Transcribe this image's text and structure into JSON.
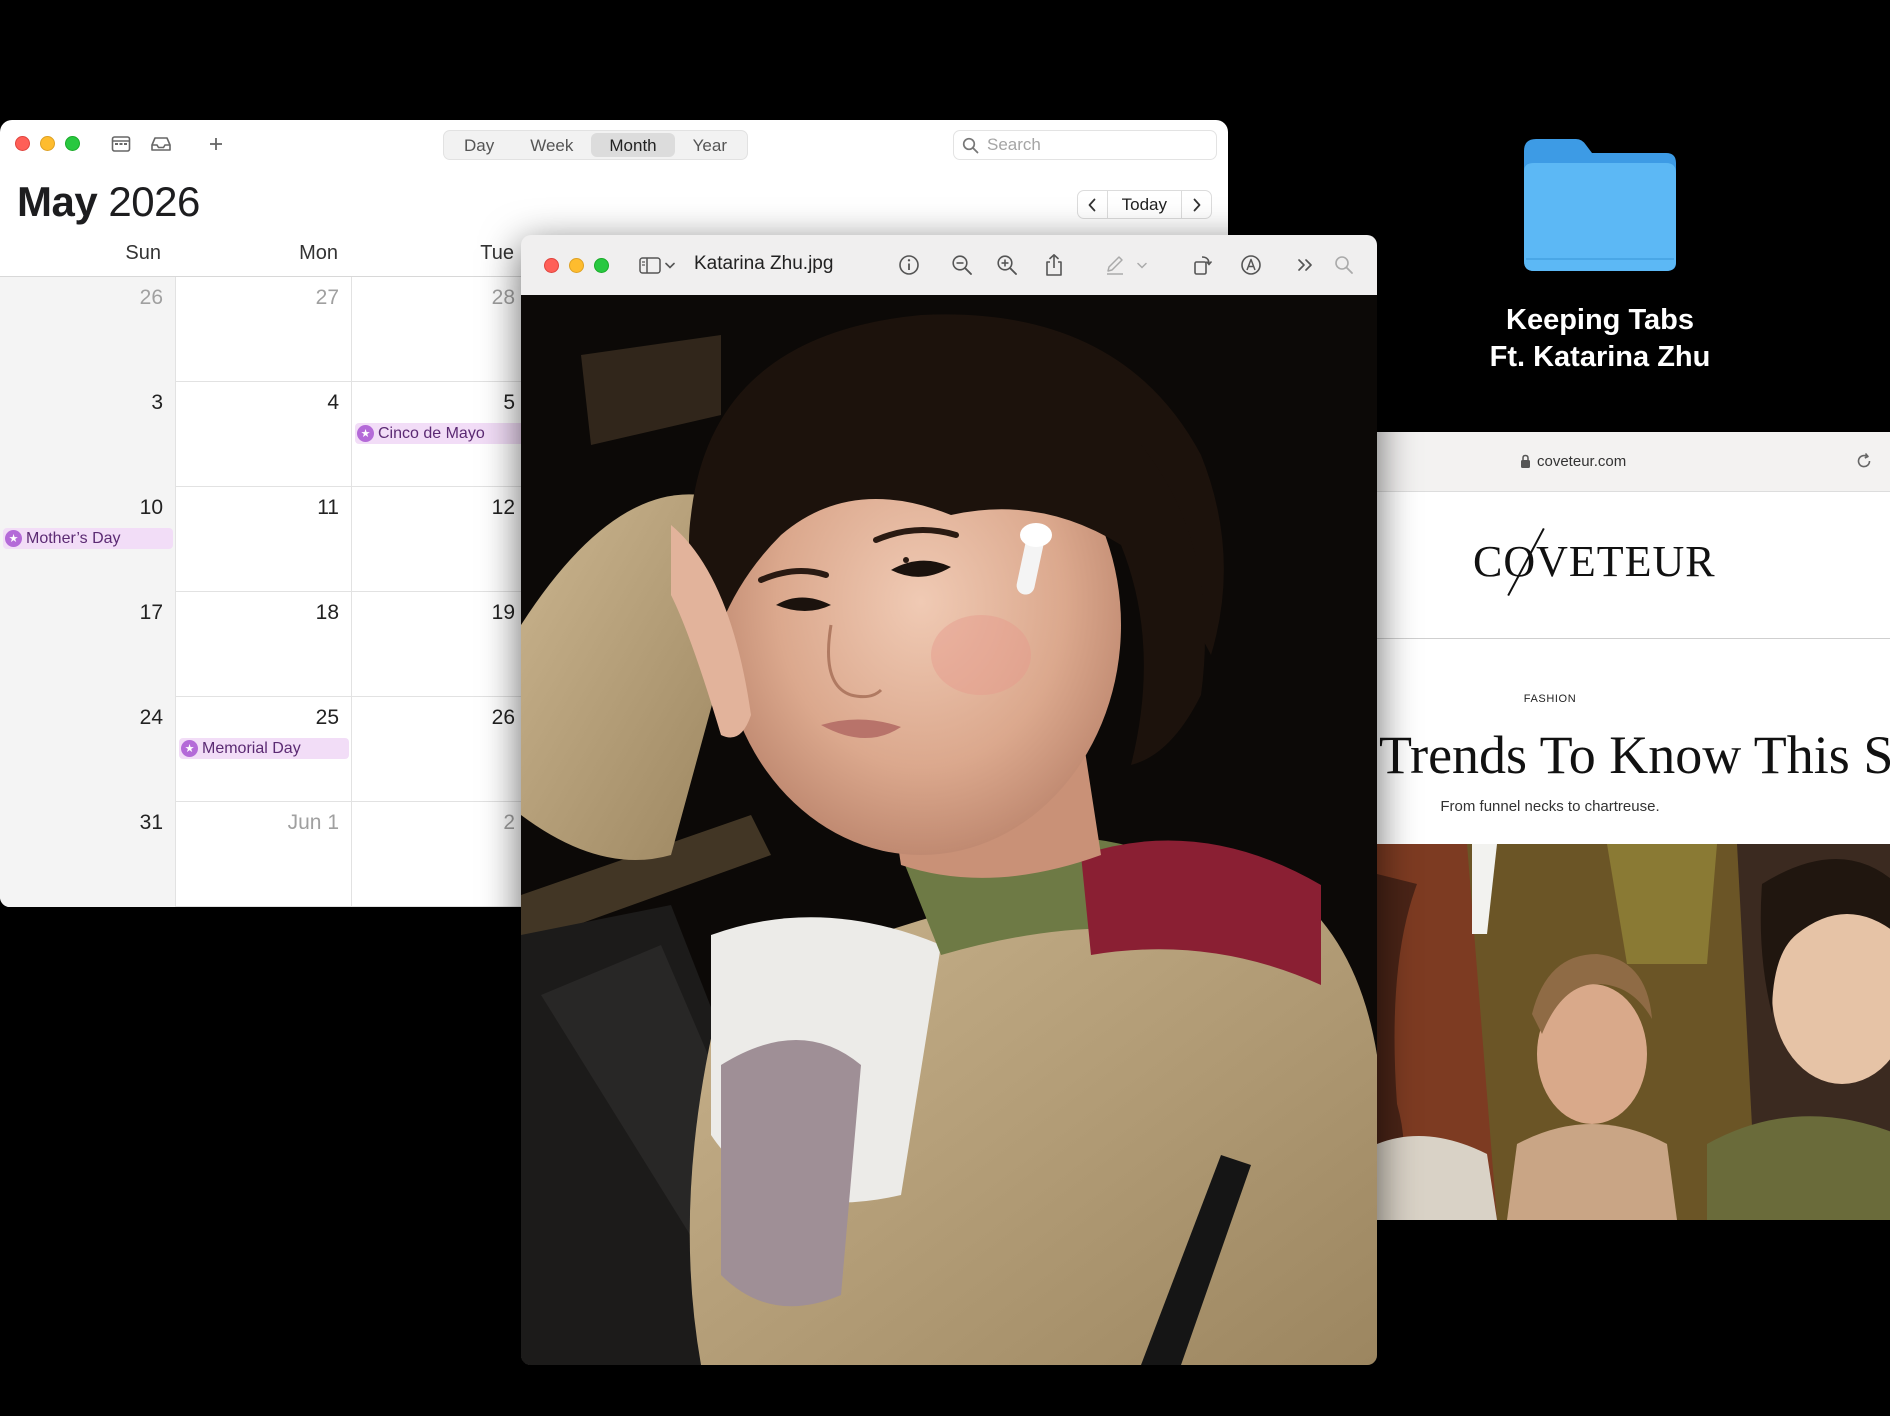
{
  "calendar": {
    "view_tabs": [
      "Day",
      "Week",
      "Month",
      "Year"
    ],
    "active_view": "Month",
    "search_placeholder": "Search",
    "month": "May",
    "year": "2026",
    "today_label": "Today",
    "weekdays": [
      "Sun",
      "Mon",
      "Tue"
    ],
    "weeks": [
      [
        {
          "day": "26",
          "muted": true
        },
        {
          "day": "27",
          "muted": true
        },
        {
          "day": "28",
          "muted": true
        }
      ],
      [
        {
          "day": "3"
        },
        {
          "day": "4"
        },
        {
          "day": "5",
          "event": "Cinco de Mayo"
        }
      ],
      [
        {
          "day": "10",
          "event": "Mother’s Day"
        },
        {
          "day": "11"
        },
        {
          "day": "12"
        }
      ],
      [
        {
          "day": "17"
        },
        {
          "day": "18"
        },
        {
          "day": "19"
        }
      ],
      [
        {
          "day": "24"
        },
        {
          "day": "25",
          "event": "Memorial Day"
        },
        {
          "day": "26"
        }
      ],
      [
        {
          "day": "31"
        },
        {
          "day": "Jun 1",
          "muted": true
        },
        {
          "day": "2",
          "muted": true
        }
      ]
    ],
    "event_color": "#f2ddf7"
  },
  "preview": {
    "filename": "Katarina Zhu.jpg",
    "toolbar_icons": [
      "sidebar-icon",
      "chevron-down-icon",
      "info-icon",
      "zoom-out-icon",
      "zoom-in-icon",
      "share-icon",
      "markup-pen-icon",
      "chevron-down-icon",
      "rotate-icon",
      "markup-circle-icon",
      "more-chevrons-icon",
      "search-icon"
    ]
  },
  "desktop": {
    "folder_label_line1": "Keeping Tabs",
    "folder_label_line2": "Ft. Katarina Zhu",
    "folder_color": "#5cb8f5"
  },
  "browser": {
    "url": "coveteur.com",
    "brand": "COVETEUR",
    "kicker": "FASHION",
    "headline": "Trends To Know This Se",
    "dek": "From funnel necks to chartreuse."
  }
}
